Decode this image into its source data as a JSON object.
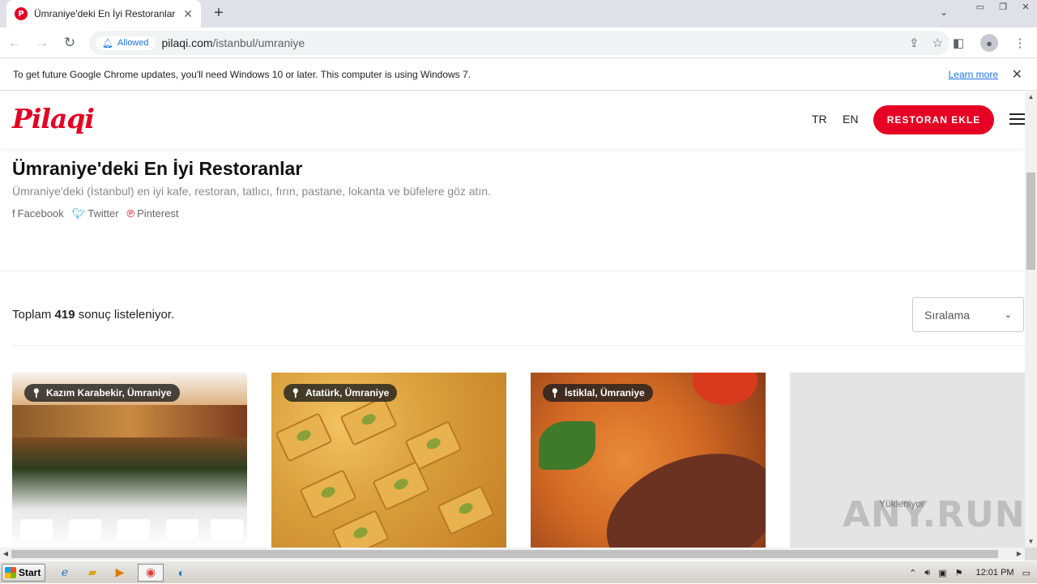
{
  "browser": {
    "tab_title": "Ümraniye'deki En İyi Restoranlar - İs",
    "tab_favicon_letter": "P",
    "permission_chip": "Allowed",
    "url_host": "pilaqi.com",
    "url_path": "/istanbul/umraniye",
    "infobar_message": "To get future Google Chrome updates, you'll need Windows 10 or later. This computer is using Windows 7.",
    "infobar_link": "Learn more"
  },
  "site": {
    "logo": "Pilaqi",
    "lang_tr": "TR",
    "lang_en": "EN",
    "add_restaurant": "RESTORAN EKLE",
    "brand_color": "#e60023"
  },
  "page": {
    "title": "Ümraniye'deki En İyi Restoranlar",
    "subtitle": "Ümraniye'deki (İstanbul) en iyi kafe, restoran, tatlıcı, fırın, pastane, lokanta ve büfelere göz atın.",
    "share": {
      "facebook": "Facebook",
      "twitter": "Twitter",
      "pinterest": "Pinterest"
    },
    "results_prefix": "Toplam",
    "results_count": "419",
    "results_suffix": "sonuç listeleniyor.",
    "sort_label": "Sıralama"
  },
  "cards": [
    {
      "location": "Kazım Karabekir, Ümraniye",
      "image": "restaurant-terrace"
    },
    {
      "location": "Atatürk, Ümraniye",
      "image": "baklava"
    },
    {
      "location": "İstiklal, Ümraniye",
      "image": "bulgur-kofte"
    },
    {
      "loading": "Yükleniyor"
    }
  ],
  "taskbar": {
    "start": "Start",
    "clock": "12:01 PM"
  },
  "watermark": "ANY.RUN"
}
